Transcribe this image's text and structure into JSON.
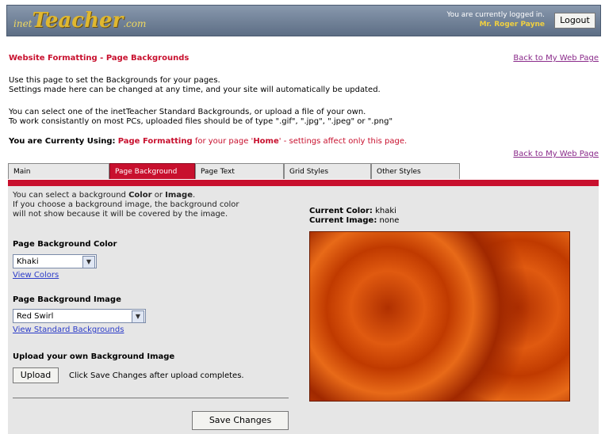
{
  "header": {
    "logo_inet": "inet",
    "logo_teacher": "Teacher",
    "logo_com": ".com",
    "logged_in_text": "You are currently logged in.",
    "user_name": "Mr. Roger Payne",
    "logout_label": "Logout"
  },
  "page": {
    "title": "Website Formatting - Page Backgrounds",
    "back_link": "Back to My Web Page",
    "intro_line1": "Use this page to set the Backgrounds for your pages.",
    "intro_line2": "Settings made here can be changed at any time, and your site will automatically be updated.",
    "info_line1": "You can select one of the inetTeacher Standard Backgrounds, or upload a file of your own.",
    "info_line2": "To work consistantly on most PCs, uploaded files should be of type \".gif\", \".jpg\", \".jpeg\" or \".png\"",
    "using_prefix": "You are Currenty Using:",
    "using_value": "Page Formatting",
    "using_mid": "for your page '",
    "using_page": "Home",
    "using_suffix": "' - settings affect only this page."
  },
  "tabs": [
    {
      "label": "Main"
    },
    {
      "label": "Page Background"
    },
    {
      "label": "Page Text"
    },
    {
      "label": "Grid Styles"
    },
    {
      "label": "Other Styles"
    }
  ],
  "panel": {
    "intro_a": "You can select a background ",
    "intro_color": "Color",
    "intro_or": " or ",
    "intro_image": "Image",
    "intro_dot": ".",
    "intro_line2": "If you choose a background image, the background color",
    "intro_line3": "will not show because it will be covered by the image.",
    "color_label": "Page Background Color",
    "color_value": "Khaki",
    "view_colors": "View Colors",
    "image_label": "Page Background Image",
    "image_value": "Red Swirl",
    "view_backgrounds": "View Standard Backgrounds",
    "upload_label": "Upload your own Background Image",
    "upload_button": "Upload",
    "upload_hint": "Click Save Changes after upload completes.",
    "save_button": "Save Changes",
    "current_color_label": "Current Color:",
    "current_color_value": "khaki",
    "current_image_label": "Current Image:",
    "current_image_value": "none"
  }
}
